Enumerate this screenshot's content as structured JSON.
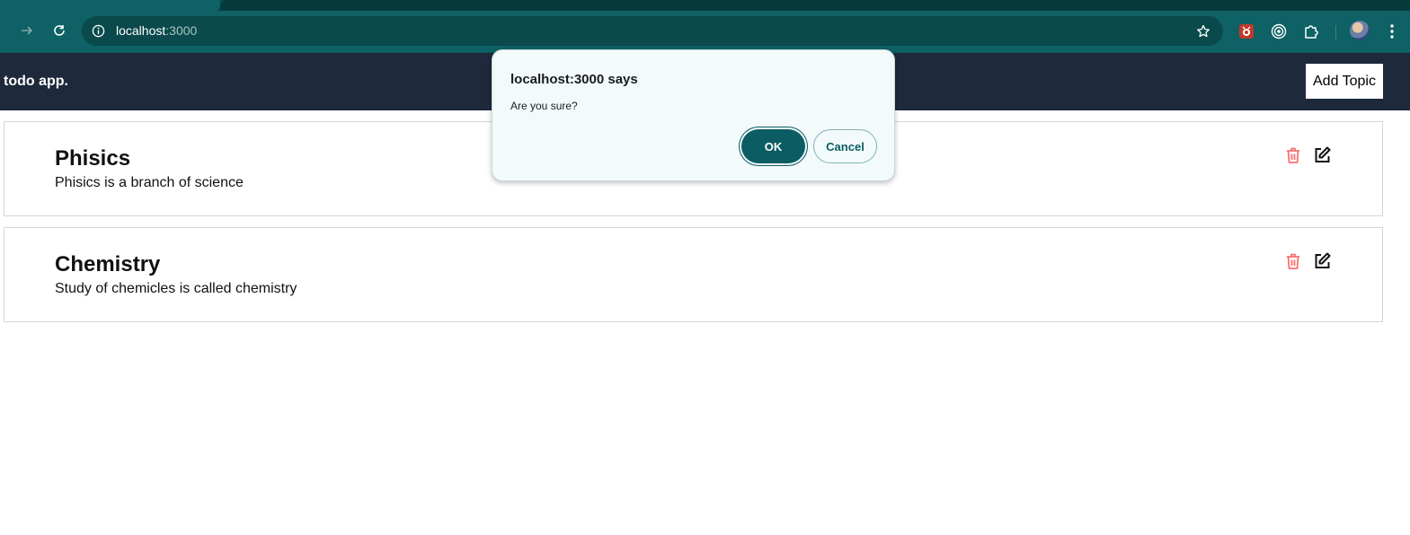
{
  "browser": {
    "url_host": "localhost",
    "url_port": ":3000",
    "icons": {
      "forward": "arrow-right-icon",
      "reload": "reload-icon",
      "site_info": "info-icon",
      "bookmark": "star-icon",
      "extensions": [
        "bug-extension-icon",
        "target-extension-icon",
        "puzzle-extensions-icon"
      ],
      "menu": "kebab-menu-icon"
    }
  },
  "app": {
    "brand": "todo app.",
    "add_topic_label": "Add Topic",
    "colors": {
      "navbar": "#1e293b",
      "delete_icon": "#f87171"
    }
  },
  "topics": [
    {
      "title": "Phisics",
      "description": "Phisics is a branch of science"
    },
    {
      "title": "Chemistry",
      "description": "Study of chemicles is called chemistry"
    }
  ],
  "dialog": {
    "title": "localhost:3000 says",
    "message": "Are you sure?",
    "ok_label": "OK",
    "cancel_label": "Cancel",
    "accent": "#0b5d63"
  }
}
